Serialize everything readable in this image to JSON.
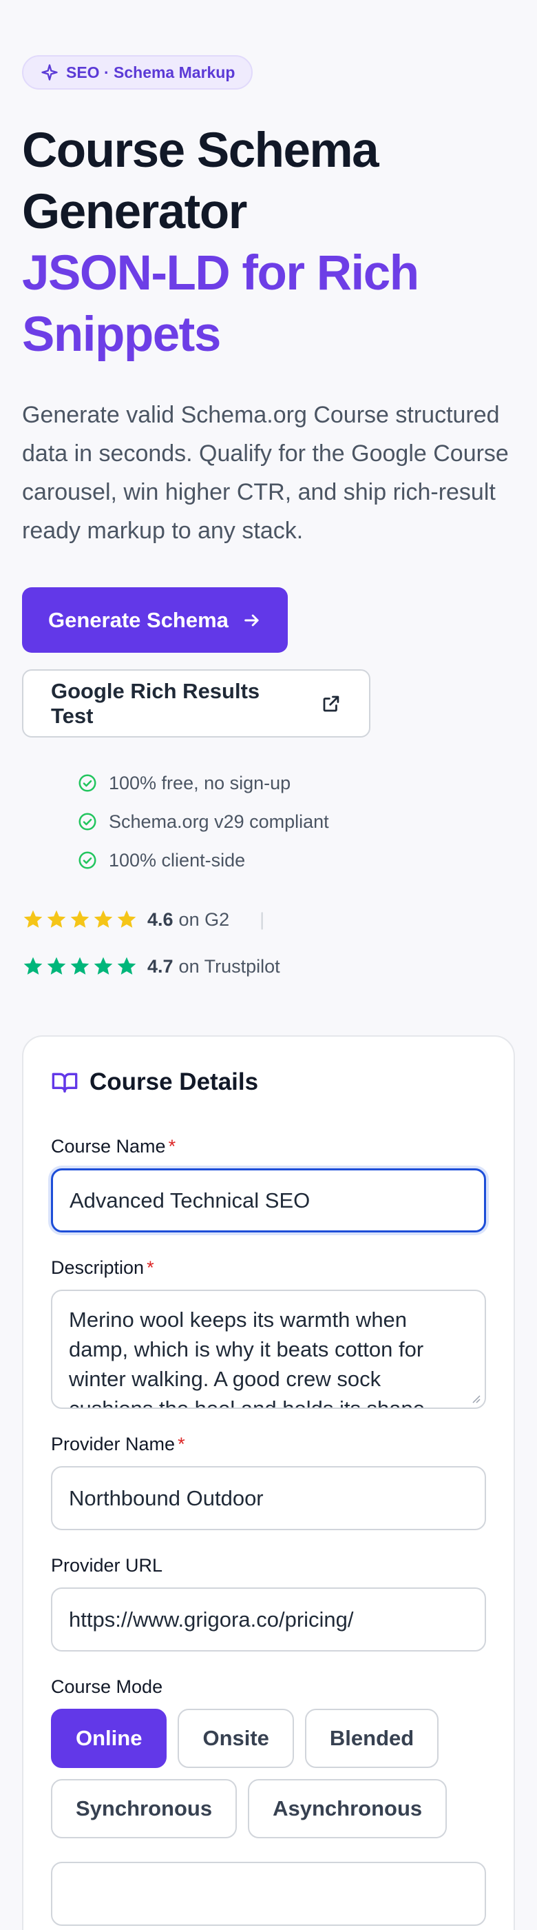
{
  "badge": {
    "label": "SEO · Schema Markup",
    "icon": "sparkle-icon"
  },
  "hero": {
    "title_line1": "Course Schema",
    "title_line2": "Generator",
    "title_accent1": "JSON-LD for Rich",
    "title_accent2": "Snippets",
    "lead": "Generate valid Schema.org Course structured data in seconds. Qualify for the Google Course carousel, win higher CTR, and ship rich-result ready markup to any stack."
  },
  "actions": {
    "primary_label": "Generate Schema",
    "secondary_label": "Google Rich Results Test"
  },
  "checks": [
    "100% free, no sign-up",
    "Schema.org v29 compliant",
    "100% client-side"
  ],
  "ratings": [
    {
      "score": "4.6",
      "source": "on G2",
      "stars": 5
    },
    {
      "score": "4.7",
      "source": "on Trustpilot",
      "stars": 5
    }
  ],
  "ratings_separator": "|",
  "colors": {
    "accent": "#6238e8",
    "g2_star": "#f5c518",
    "trustpilot_star": "#00b67a",
    "check": "#22c55e",
    "required": "#dc2626"
  },
  "form": {
    "title": "Course Details",
    "course_name": {
      "label": "Course Name",
      "required": "*",
      "value": "Advanced Technical SEO"
    },
    "description": {
      "label": "Description",
      "required": "*",
      "value": "Merino wool keeps its warmth when damp, which is why it beats cotton for winter walking. A good crew sock cushions the heel and holds its shape."
    },
    "provider_name": {
      "label": "Provider Name",
      "required": "*",
      "value": "Northbound Outdoor"
    },
    "provider_url": {
      "label": "Provider URL",
      "value": "https://www.grigora.co/pricing/"
    },
    "course_mode": {
      "label": "Course Mode",
      "options": [
        "Online",
        "Onsite",
        "Blended",
        "Synchronous",
        "Asynchronous"
      ],
      "selected": "Online"
    }
  }
}
